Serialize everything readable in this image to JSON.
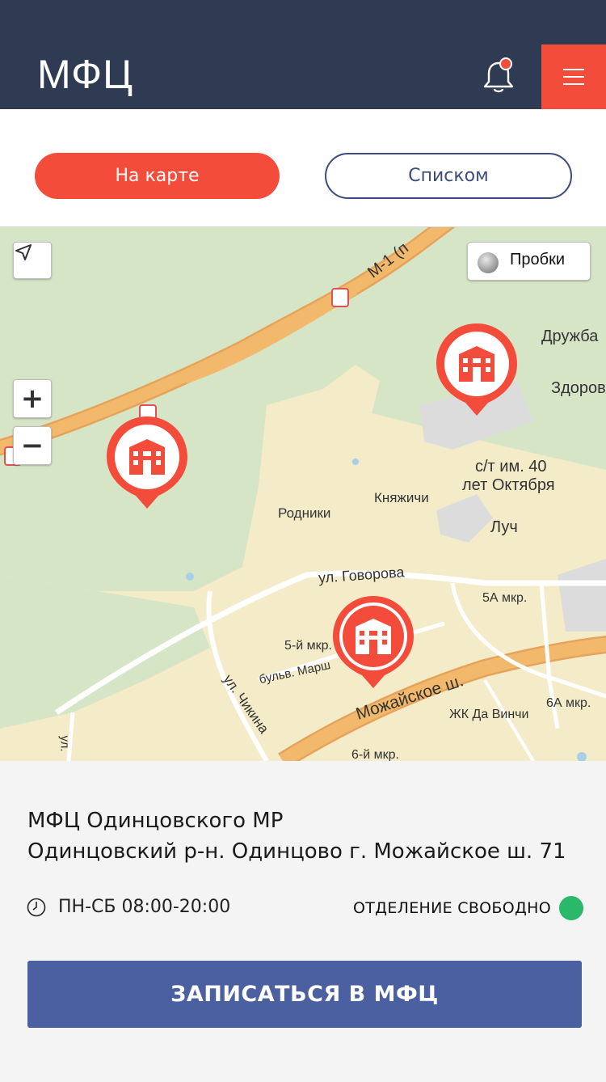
{
  "app": {
    "title": "МФЦ"
  },
  "header": {
    "notification_icon": "bell-icon",
    "menu_icon": "hamburger-icon",
    "accent_color": "#f44c3a",
    "bg_color": "#2f3b52"
  },
  "view_toggle": {
    "map_label": "На карте",
    "list_label": "Списком",
    "active": "map"
  },
  "map": {
    "traffic_label": "Пробки",
    "controls": {
      "zoom_in": "+",
      "zoom_out": "−"
    },
    "labels": {
      "road_m1": "М-1 (п",
      "druzhba": "Дружба",
      "zdorov": "Здоров",
      "st_line1": "с/т им. 40",
      "st_line2": "лет Октября",
      "knyazhichi": "Княжичи",
      "rodniki": "Родники",
      "luch": "Луч",
      "govorova": "ул. Говорова",
      "mkr5a": "5А мкр.",
      "mkr5": "5-й мкр.",
      "marshala": "бульв. Марш",
      "mozhayskoe": "Можайское ш.",
      "chikina": "ул. Чикина",
      "mkr6a": "6А мкр.",
      "davinchi": "ЖК Да Винчи",
      "mkr6": "6-й мкр.",
      "ul": "ул."
    },
    "markers": [
      "mfc-marker-1",
      "mfc-marker-2",
      "mfc-marker-3"
    ]
  },
  "office": {
    "name": "МФЦ Одинцовского МР",
    "address": "Одинцовский р-н. Одинцово г. Можайское ш. 71",
    "hours": "ПН-СБ 08:00-20:00",
    "status": "ОТДЕЛЕНИЕ СВОБОДНО",
    "status_color": "#2ab86a"
  },
  "cta": {
    "label": "ЗАПИСАТЬСЯ В МФЦ"
  }
}
